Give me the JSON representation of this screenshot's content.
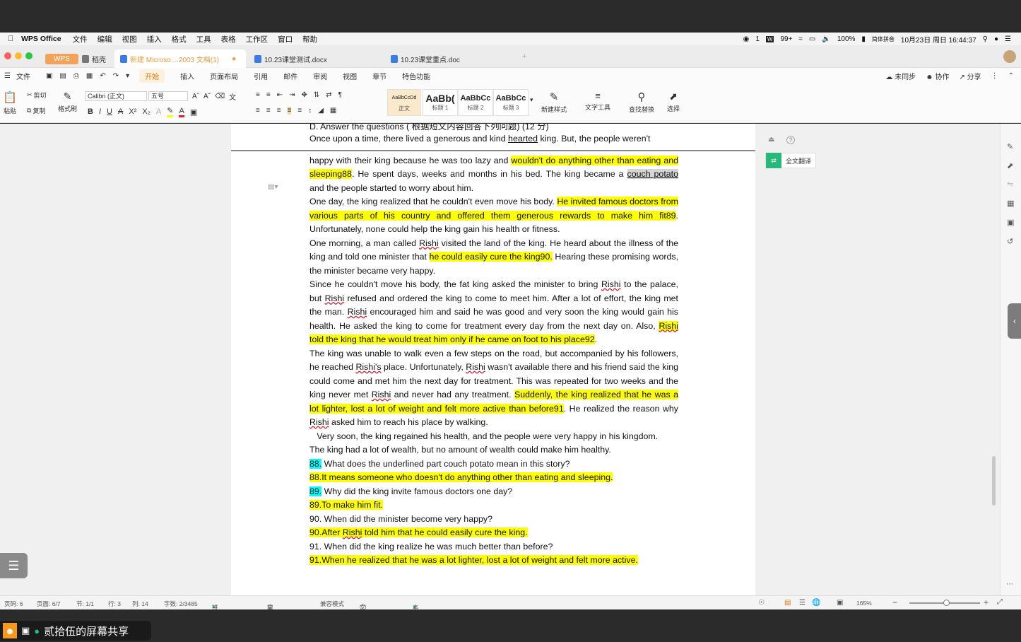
{
  "mac_menubar": {
    "app_name": "WPS Office",
    "items": [
      "文件",
      "编辑",
      "视图",
      "插入",
      "格式",
      "工具",
      "表格",
      "工作区",
      "窗口",
      "帮助"
    ],
    "wechat_badge": "1",
    "badge_99": "99+",
    "battery": "100%",
    "input_method": "简体拼音",
    "datetime": "10月23日 周日 16:44:37"
  },
  "tabs": {
    "wps_home": "WPS",
    "daoke": "稻壳",
    "doc1": "新建 Microso....2003 文档(1)",
    "doc2": "10.23课堂测试.docx",
    "doc3": "10.23课堂重点.doc"
  },
  "menu": {
    "file": "文件",
    "items": [
      "开始",
      "插入",
      "页面布局",
      "引用",
      "邮件",
      "审阅",
      "视图",
      "章节",
      "特色功能"
    ],
    "active": "开始",
    "sync": "未同步",
    "collab": "协作",
    "share": "分享"
  },
  "ribbon": {
    "paste": "粘贴",
    "cut": "剪切",
    "copy": "复制",
    "format_painter": "格式刷",
    "font_name": "Calibri (正文)",
    "font_size": "五号",
    "styles": [
      {
        "preview": "AaBbCcDd",
        "caption": "正文"
      },
      {
        "preview": "AaBb(",
        "caption": "标题 1"
      },
      {
        "preview": "AaBbCc",
        "caption": "标题 2"
      },
      {
        "preview": "AaBbCc",
        "caption": "标题 3"
      }
    ],
    "new_style": "新建样式",
    "text_tools": "文字工具",
    "find_replace": "查找替换",
    "select": "选择"
  },
  "translate_button": "全文翻译",
  "document": {
    "lines": {
      "l0": "D. Answer the questions ( 根据短文内容回答下列问题) (12 分)",
      "p1a": "Once upon a time, there lived a generous and kind ",
      "p1b": "hearted",
      "p1c": " king. But, the people weren't",
      "p2a": "happy with their king because he was too lazy and ",
      "p2b": "wouldn't do anything other than eating and sleeping88",
      "p2c": ". He spent days, weeks and months in his bed. The king became a ",
      "p2d": "couch potato",
      "p2e": " and the people started to worry about him.",
      "p3a": "One day, the king realized that he couldn't even move his body. ",
      "p3b": "He invited famous doctors from various parts of his country and offered them generous rewards to make him fit89",
      "p3c": ". Unfortunately, none could help the king gain his health or fitness.",
      "p4a": "One morning, a man called ",
      "p4b": "Rishi",
      "p4c": " visited the land of the king. He heard about the illness of the king and told one minister that ",
      "p4d": "he could easily cure the king90.",
      "p4e": " Hearing these promising words, the minister became very happy.",
      "p5a": "Since he couldn't move his body, the fat king asked the minister to bring ",
      "p5b": "Rishi",
      "p5c": " to the palace, but ",
      "p5d": "Rishi",
      "p5e": " refused and ordered the king to come to meet him. After a lot of effort, the king met the man. ",
      "p5f": "Rishi",
      "p5g": " encouraged him and said he was good and very soon the king would gain his health. He asked the king to come for treatment every day from the next day on. Also, ",
      "p5h": "Rishi",
      "p5i": " told the king that he would treat him only if he came on foot to his place92",
      "p5j": ".",
      "p6a": "The king was unable to walk even a few steps on the road, but accompanied by his followers, he reached ",
      "p6b": "Rishi's",
      "p6c": " place. Unfortunately, ",
      "p6d": "Rishi",
      "p6e": " wasn't available there and his friend said the king could come and met him the next day for treatment. This was repeated for two weeks and the king never met ",
      "p6f": "Rishi",
      "p6g": " and never had any treatment. ",
      "p6h": "Suddenly, the king realized that he was a lot lighter, lost a lot of weight and felt more active than before91",
      "p6i": ". He realized the reason why ",
      "p6j": "Rishi",
      "p6k": " asked him to reach his place by walking.",
      "p7": "   Very soon, the king regained his health, and the people were very happy in his kingdom.",
      "p8": "The king had a lot of wealth, but no amount of wealth could make him healthy.",
      "q88_num": "88.",
      "q88": " What does the underlined part couch potato mean in this story?",
      "a88": "88.It means someone who doesn't do anything other than eating and sleeping.",
      "q89_num": "89.",
      "q89": " Why did the king invite famous doctors one day?",
      "a89": "89.To make him fit.",
      "q90": "90. When did the minister become very happy?",
      "a90a": "90.After ",
      "a90b": "Rishi",
      "a90c": " told him that he could easily cure the king.",
      "q91": "91. When did the king realize he was much better than before?",
      "a91": "91.When he realized that he was a lot lighter, lost a lot of weight and felt more active."
    }
  },
  "status": {
    "page_num": "页码: 6",
    "pages": "页面: 6/7",
    "section": "节: 1/1",
    "row": "行: 3",
    "col": "列: 14",
    "words": "字数: 2/3485",
    "spell": "拼写检查",
    "proof": "文档校对",
    "compat": "兼容模式",
    "protect": "文档未保护",
    "backup": "本地备份开",
    "zoom": "165%"
  },
  "screen_share": "贰拾伍的屏幕共享",
  "colors": {
    "highlight_yellow": "#ffff00",
    "highlight_cyan": "#00ffff",
    "accent_orange": "#d27b14"
  }
}
